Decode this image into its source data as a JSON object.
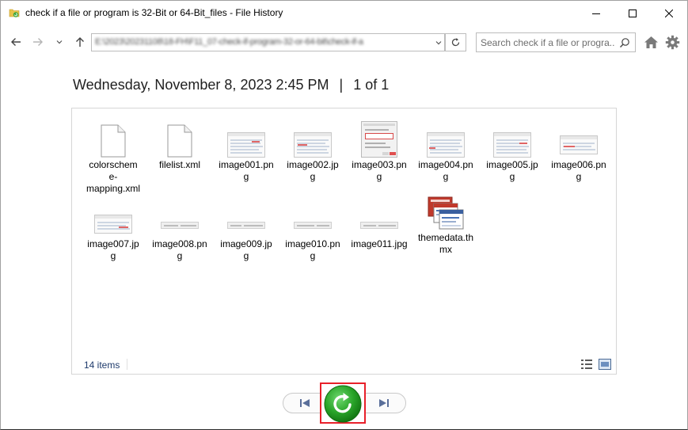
{
  "window": {
    "title": "check if a file or program is 32-Bit or 64-Bit_files - File History"
  },
  "nav": {
    "address": "E:\\2023\\20231108\\18-FH\\F11_07-check-if-program-32-or-64-bit\\check-if-a",
    "search_placeholder": "Search check if a file or progra..."
  },
  "header": {
    "datetime": "Wednesday, November 8, 2023 2:45 PM",
    "separator": "|",
    "page": "1 of 1"
  },
  "files": [
    {
      "name": "colorscheme­mapping.xml",
      "kind": "doc"
    },
    {
      "name": "filelist.xml",
      "kind": "doc"
    },
    {
      "name": "image001.png",
      "kind": "shot"
    },
    {
      "name": "image002.jpg",
      "kind": "shot"
    },
    {
      "name": "image003.png",
      "kind": "dialog"
    },
    {
      "name": "image004.png",
      "kind": "shot"
    },
    {
      "name": "image005.jpg",
      "kind": "shot"
    },
    {
      "name": "image006.png",
      "kind": "shot-small"
    },
    {
      "name": "image007.jpg",
      "kind": "shot-small"
    },
    {
      "name": "image008.png",
      "kind": "strip"
    },
    {
      "name": "image009.jpg",
      "kind": "strip"
    },
    {
      "name": "image010.png",
      "kind": "strip"
    },
    {
      "name": "image011.jpg",
      "kind": "strip"
    },
    {
      "name": "themedata.thmx",
      "kind": "theme"
    }
  ],
  "status": {
    "count": "14 items"
  },
  "colors": {
    "restore_green": "#2aa52a",
    "highlight_red": "#e8202a",
    "status_text": "#1e3a6b"
  }
}
